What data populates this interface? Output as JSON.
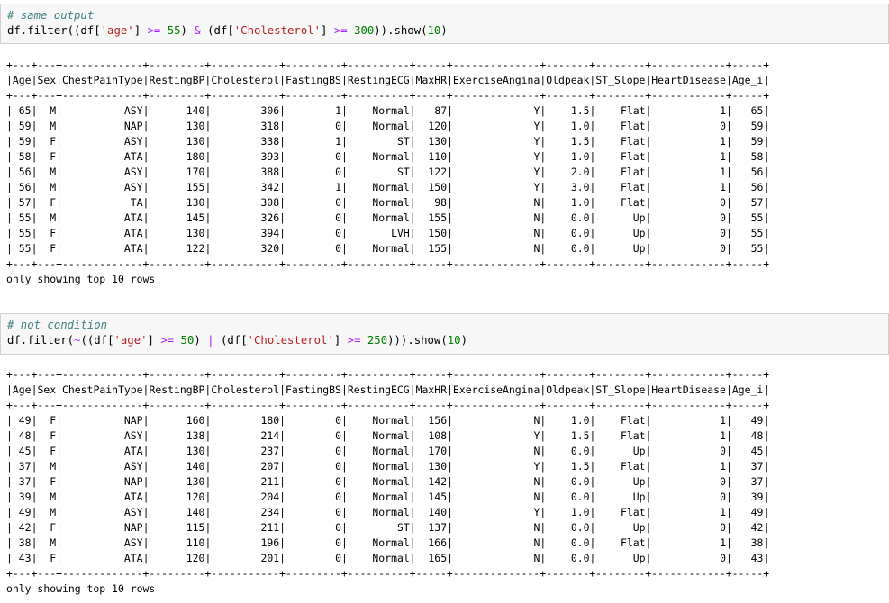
{
  "cells": [
    {
      "comment": "# same output",
      "code": [
        {
          "t": "df.filter((df[",
          "c": ""
        },
        {
          "t": "'age'",
          "c": "s"
        },
        {
          "t": "] ",
          "c": ""
        },
        {
          "t": ">=",
          "c": "o"
        },
        {
          "t": " ",
          "c": ""
        },
        {
          "t": "55",
          "c": "n"
        },
        {
          "t": ") ",
          "c": ""
        },
        {
          "t": "&",
          "c": "o"
        },
        {
          "t": " (df[",
          "c": ""
        },
        {
          "t": "'Cholesterol'",
          "c": "s"
        },
        {
          "t": "] ",
          "c": ""
        },
        {
          "t": ">=",
          "c": "o"
        },
        {
          "t": " ",
          "c": ""
        },
        {
          "t": "300",
          "c": "n"
        },
        {
          "t": ")).show(",
          "c": ""
        },
        {
          "t": "10",
          "c": "n"
        },
        {
          "t": ")",
          "c": ""
        }
      ],
      "output": {
        "columns": [
          "Age",
          "Sex",
          "ChestPainType",
          "RestingBP",
          "Cholesterol",
          "FastingBS",
          "RestingECG",
          "MaxHR",
          "ExerciseAngina",
          "Oldpeak",
          "ST_Slope",
          "HeartDisease",
          "Age_i"
        ],
        "rows": [
          [
            "65",
            "M",
            "ASY",
            "140",
            "306",
            "1",
            "Normal",
            "87",
            "Y",
            "1.5",
            "Flat",
            "1",
            "65"
          ],
          [
            "59",
            "M",
            "NAP",
            "130",
            "318",
            "0",
            "Normal",
            "120",
            "Y",
            "1.0",
            "Flat",
            "0",
            "59"
          ],
          [
            "59",
            "F",
            "ASY",
            "130",
            "338",
            "1",
            "ST",
            "130",
            "Y",
            "1.5",
            "Flat",
            "1",
            "59"
          ],
          [
            "58",
            "F",
            "ATA",
            "180",
            "393",
            "0",
            "Normal",
            "110",
            "Y",
            "1.0",
            "Flat",
            "1",
            "58"
          ],
          [
            "56",
            "M",
            "ASY",
            "170",
            "388",
            "0",
            "ST",
            "122",
            "Y",
            "2.0",
            "Flat",
            "1",
            "56"
          ],
          [
            "56",
            "M",
            "ASY",
            "155",
            "342",
            "1",
            "Normal",
            "150",
            "Y",
            "3.0",
            "Flat",
            "1",
            "56"
          ],
          [
            "57",
            "F",
            "TA",
            "130",
            "308",
            "0",
            "Normal",
            "98",
            "N",
            "1.0",
            "Flat",
            "0",
            "57"
          ],
          [
            "55",
            "M",
            "ATA",
            "145",
            "326",
            "0",
            "Normal",
            "155",
            "N",
            "0.0",
            "Up",
            "0",
            "55"
          ],
          [
            "55",
            "F",
            "ATA",
            "130",
            "394",
            "0",
            "LVH",
            "150",
            "N",
            "0.0",
            "Up",
            "0",
            "55"
          ],
          [
            "55",
            "F",
            "ATA",
            "122",
            "320",
            "0",
            "Normal",
            "155",
            "N",
            "0.0",
            "Up",
            "0",
            "55"
          ]
        ],
        "footer": "only showing top 10 rows"
      }
    },
    {
      "comment": "# not condition",
      "code": [
        {
          "t": "df.filter(",
          "c": ""
        },
        {
          "t": "~",
          "c": "o"
        },
        {
          "t": "((df[",
          "c": ""
        },
        {
          "t": "'age'",
          "c": "s"
        },
        {
          "t": "] ",
          "c": ""
        },
        {
          "t": ">=",
          "c": "o"
        },
        {
          "t": " ",
          "c": ""
        },
        {
          "t": "50",
          "c": "n"
        },
        {
          "t": ") ",
          "c": ""
        },
        {
          "t": "|",
          "c": "o"
        },
        {
          "t": " (df[",
          "c": ""
        },
        {
          "t": "'Cholesterol'",
          "c": "s"
        },
        {
          "t": "] ",
          "c": ""
        },
        {
          "t": ">=",
          "c": "o"
        },
        {
          "t": " ",
          "c": ""
        },
        {
          "t": "250",
          "c": "n"
        },
        {
          "t": "))).show(",
          "c": ""
        },
        {
          "t": "10",
          "c": "n"
        },
        {
          "t": ")",
          "c": ""
        }
      ],
      "output": {
        "columns": [
          "Age",
          "Sex",
          "ChestPainType",
          "RestingBP",
          "Cholesterol",
          "FastingBS",
          "RestingECG",
          "MaxHR",
          "ExerciseAngina",
          "Oldpeak",
          "ST_Slope",
          "HeartDisease",
          "Age_i"
        ],
        "rows": [
          [
            "49",
            "F",
            "NAP",
            "160",
            "180",
            "0",
            "Normal",
            "156",
            "N",
            "1.0",
            "Flat",
            "1",
            "49"
          ],
          [
            "48",
            "F",
            "ASY",
            "138",
            "214",
            "0",
            "Normal",
            "108",
            "Y",
            "1.5",
            "Flat",
            "1",
            "48"
          ],
          [
            "45",
            "F",
            "ATA",
            "130",
            "237",
            "0",
            "Normal",
            "170",
            "N",
            "0.0",
            "Up",
            "0",
            "45"
          ],
          [
            "37",
            "M",
            "ASY",
            "140",
            "207",
            "0",
            "Normal",
            "130",
            "Y",
            "1.5",
            "Flat",
            "1",
            "37"
          ],
          [
            "37",
            "F",
            "NAP",
            "130",
            "211",
            "0",
            "Normal",
            "142",
            "N",
            "0.0",
            "Up",
            "0",
            "37"
          ],
          [
            "39",
            "M",
            "ATA",
            "120",
            "204",
            "0",
            "Normal",
            "145",
            "N",
            "0.0",
            "Up",
            "0",
            "39"
          ],
          [
            "49",
            "M",
            "ASY",
            "140",
            "234",
            "0",
            "Normal",
            "140",
            "Y",
            "1.0",
            "Flat",
            "1",
            "49"
          ],
          [
            "42",
            "F",
            "NAP",
            "115",
            "211",
            "0",
            "ST",
            "137",
            "N",
            "0.0",
            "Up",
            "0",
            "42"
          ],
          [
            "38",
            "M",
            "ASY",
            "110",
            "196",
            "0",
            "Normal",
            "166",
            "N",
            "0.0",
            "Flat",
            "1",
            "38"
          ],
          [
            "43",
            "F",
            "ATA",
            "120",
            "201",
            "0",
            "Normal",
            "165",
            "N",
            "0.0",
            "Up",
            "0",
            "43"
          ]
        ],
        "footer": "only showing top 10 rows"
      }
    }
  ]
}
